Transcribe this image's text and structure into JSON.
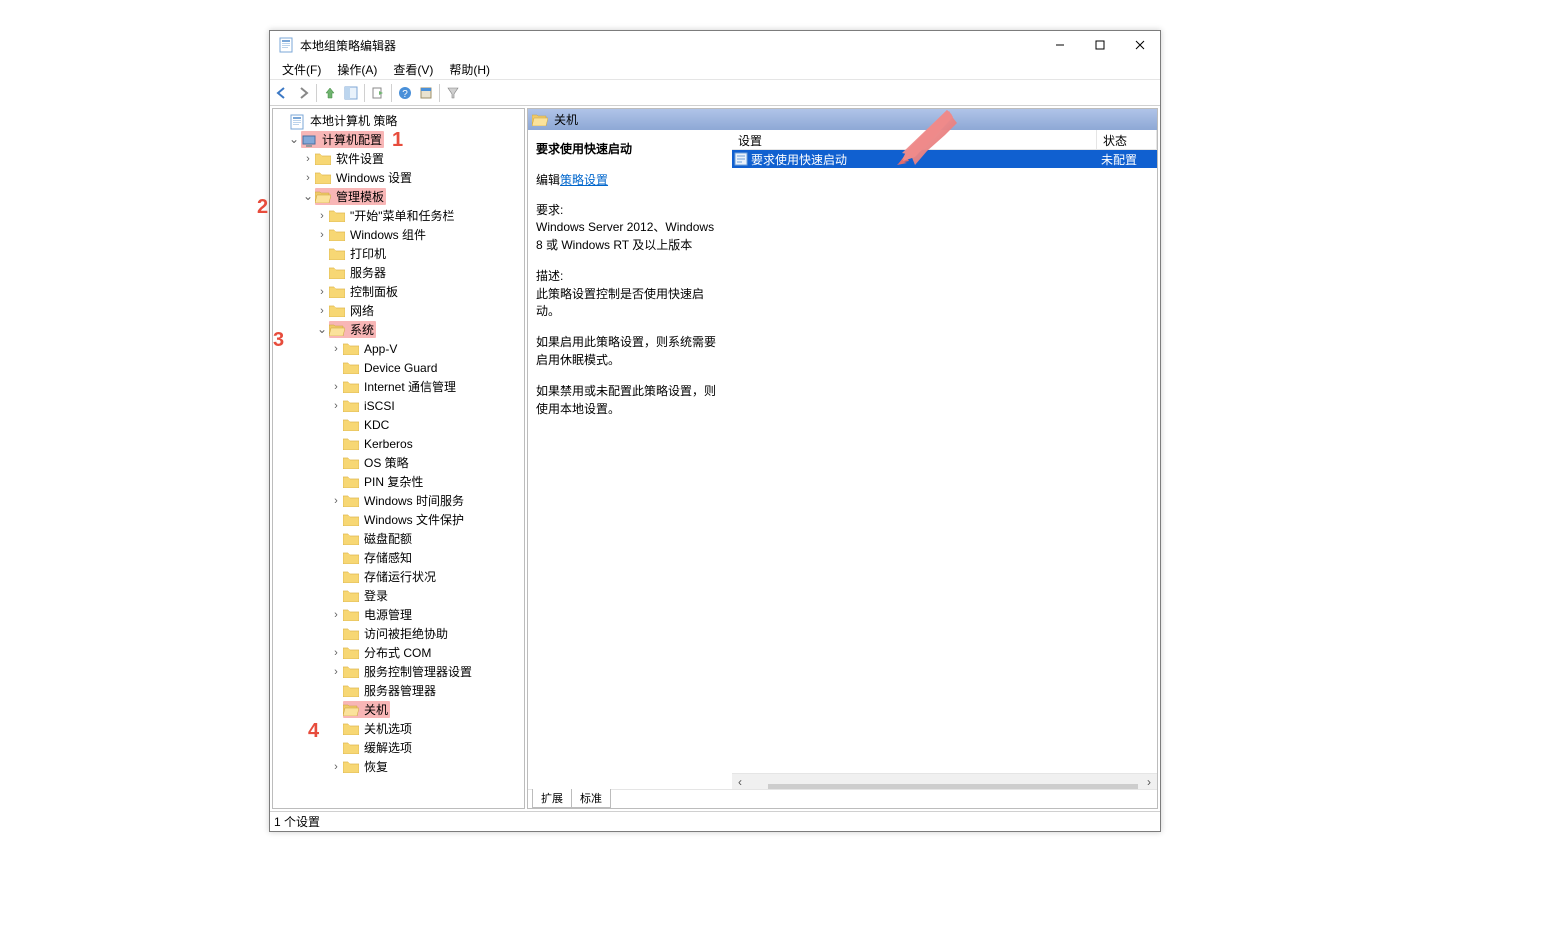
{
  "window": {
    "title": "本地组策略编辑器"
  },
  "menu": {
    "file": "文件(F)",
    "action": "操作(A)",
    "view": "查看(V)",
    "help": "帮助(H)"
  },
  "tree": {
    "root": "本地计算机 策略",
    "computer_config": "计算机配置",
    "software_settings": "软件设置",
    "windows_settings": "Windows 设置",
    "admin_templates": "管理模板",
    "start_taskbar": "\"开始\"菜单和任务栏",
    "windows_components": "Windows 组件",
    "printers": "打印机",
    "servers": "服务器",
    "control_panel": "控制面板",
    "network": "网络",
    "system": "系统",
    "app_v": "App-V",
    "device_guard": "Device Guard",
    "internet_comm": "Internet 通信管理",
    "iscsi": "iSCSI",
    "kdc": "KDC",
    "kerberos": "Kerberos",
    "os_policy": "OS 策略",
    "pin_complex": "PIN 复杂性",
    "windows_time": "Windows 时间服务",
    "windows_file_prot": "Windows 文件保护",
    "disk_quota": "磁盘配额",
    "storage_sense": "存储感知",
    "storage_health": "存储运行状况",
    "logon": "登录",
    "power_mgmt": "电源管理",
    "denied_assist": "访问被拒绝协助",
    "dcom": "分布式 COM",
    "scm_settings": "服务控制管理器设置",
    "server_manager": "服务器管理器",
    "shutdown": "关机",
    "shutdown_options": "关机选项",
    "mitigation": "缓解选项",
    "recovery": "恢复"
  },
  "detail": {
    "header": "关机",
    "policy_name": "要求使用快速启动",
    "edit_prefix": "编辑",
    "edit_link": "策略设置",
    "req_label": "要求:",
    "req_body": "Windows Server 2012、Windows 8 或 Windows RT 及以上版本",
    "desc_label": "描述:",
    "desc_1": "此策略设置控制是否使用快速启动。",
    "desc_2": "如果启用此策略设置，则系统需要启用休眠模式。",
    "desc_3": "如果禁用或未配置此策略设置，则使用本地设置。",
    "col_setting": "设置",
    "col_state": "状态",
    "row_setting": "要求使用快速启动",
    "row_state": "未配置",
    "tab_extended": "扩展",
    "tab_standard": "标准"
  },
  "status": {
    "text": "1 个设置"
  },
  "annotations": {
    "n1": "1",
    "n2": "2",
    "n3": "3",
    "n4": "4"
  }
}
